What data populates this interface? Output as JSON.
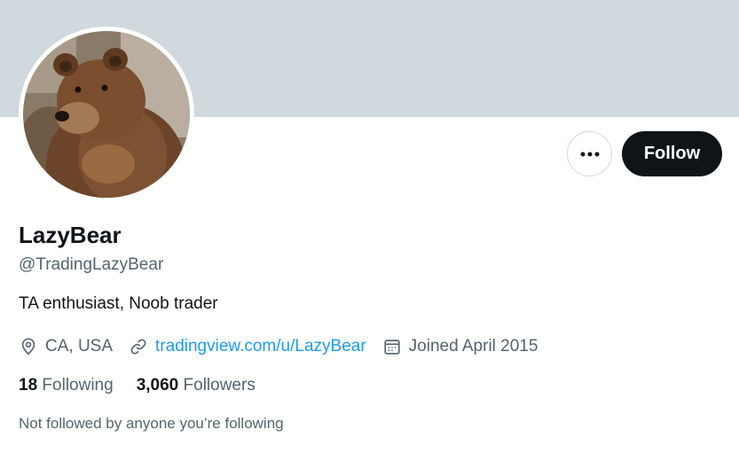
{
  "profile": {
    "display_name": "LazyBear",
    "handle": "@TradingLazyBear",
    "bio": "TA enthusiast, Noob trader",
    "location": "CA, USA",
    "website": "tradingview.com/u/LazyBear",
    "joined": "Joined April 2015"
  },
  "actions": {
    "more_icon": "ellipsis-icon",
    "follow_label": "Follow"
  },
  "stats": {
    "following_count": "18",
    "following_label": "Following",
    "followers_count": "3,060",
    "followers_label": "Followers"
  },
  "followed_note": "Not followed by anyone you’re following",
  "icons": {
    "location": "location-pin-icon",
    "website": "link-icon",
    "joined": "calendar-icon"
  },
  "colors": {
    "banner": "#cfd9de",
    "text_primary": "#0f1419",
    "text_secondary": "#536471",
    "link": "#1d9bf0",
    "follow_button": "#0f1419"
  }
}
